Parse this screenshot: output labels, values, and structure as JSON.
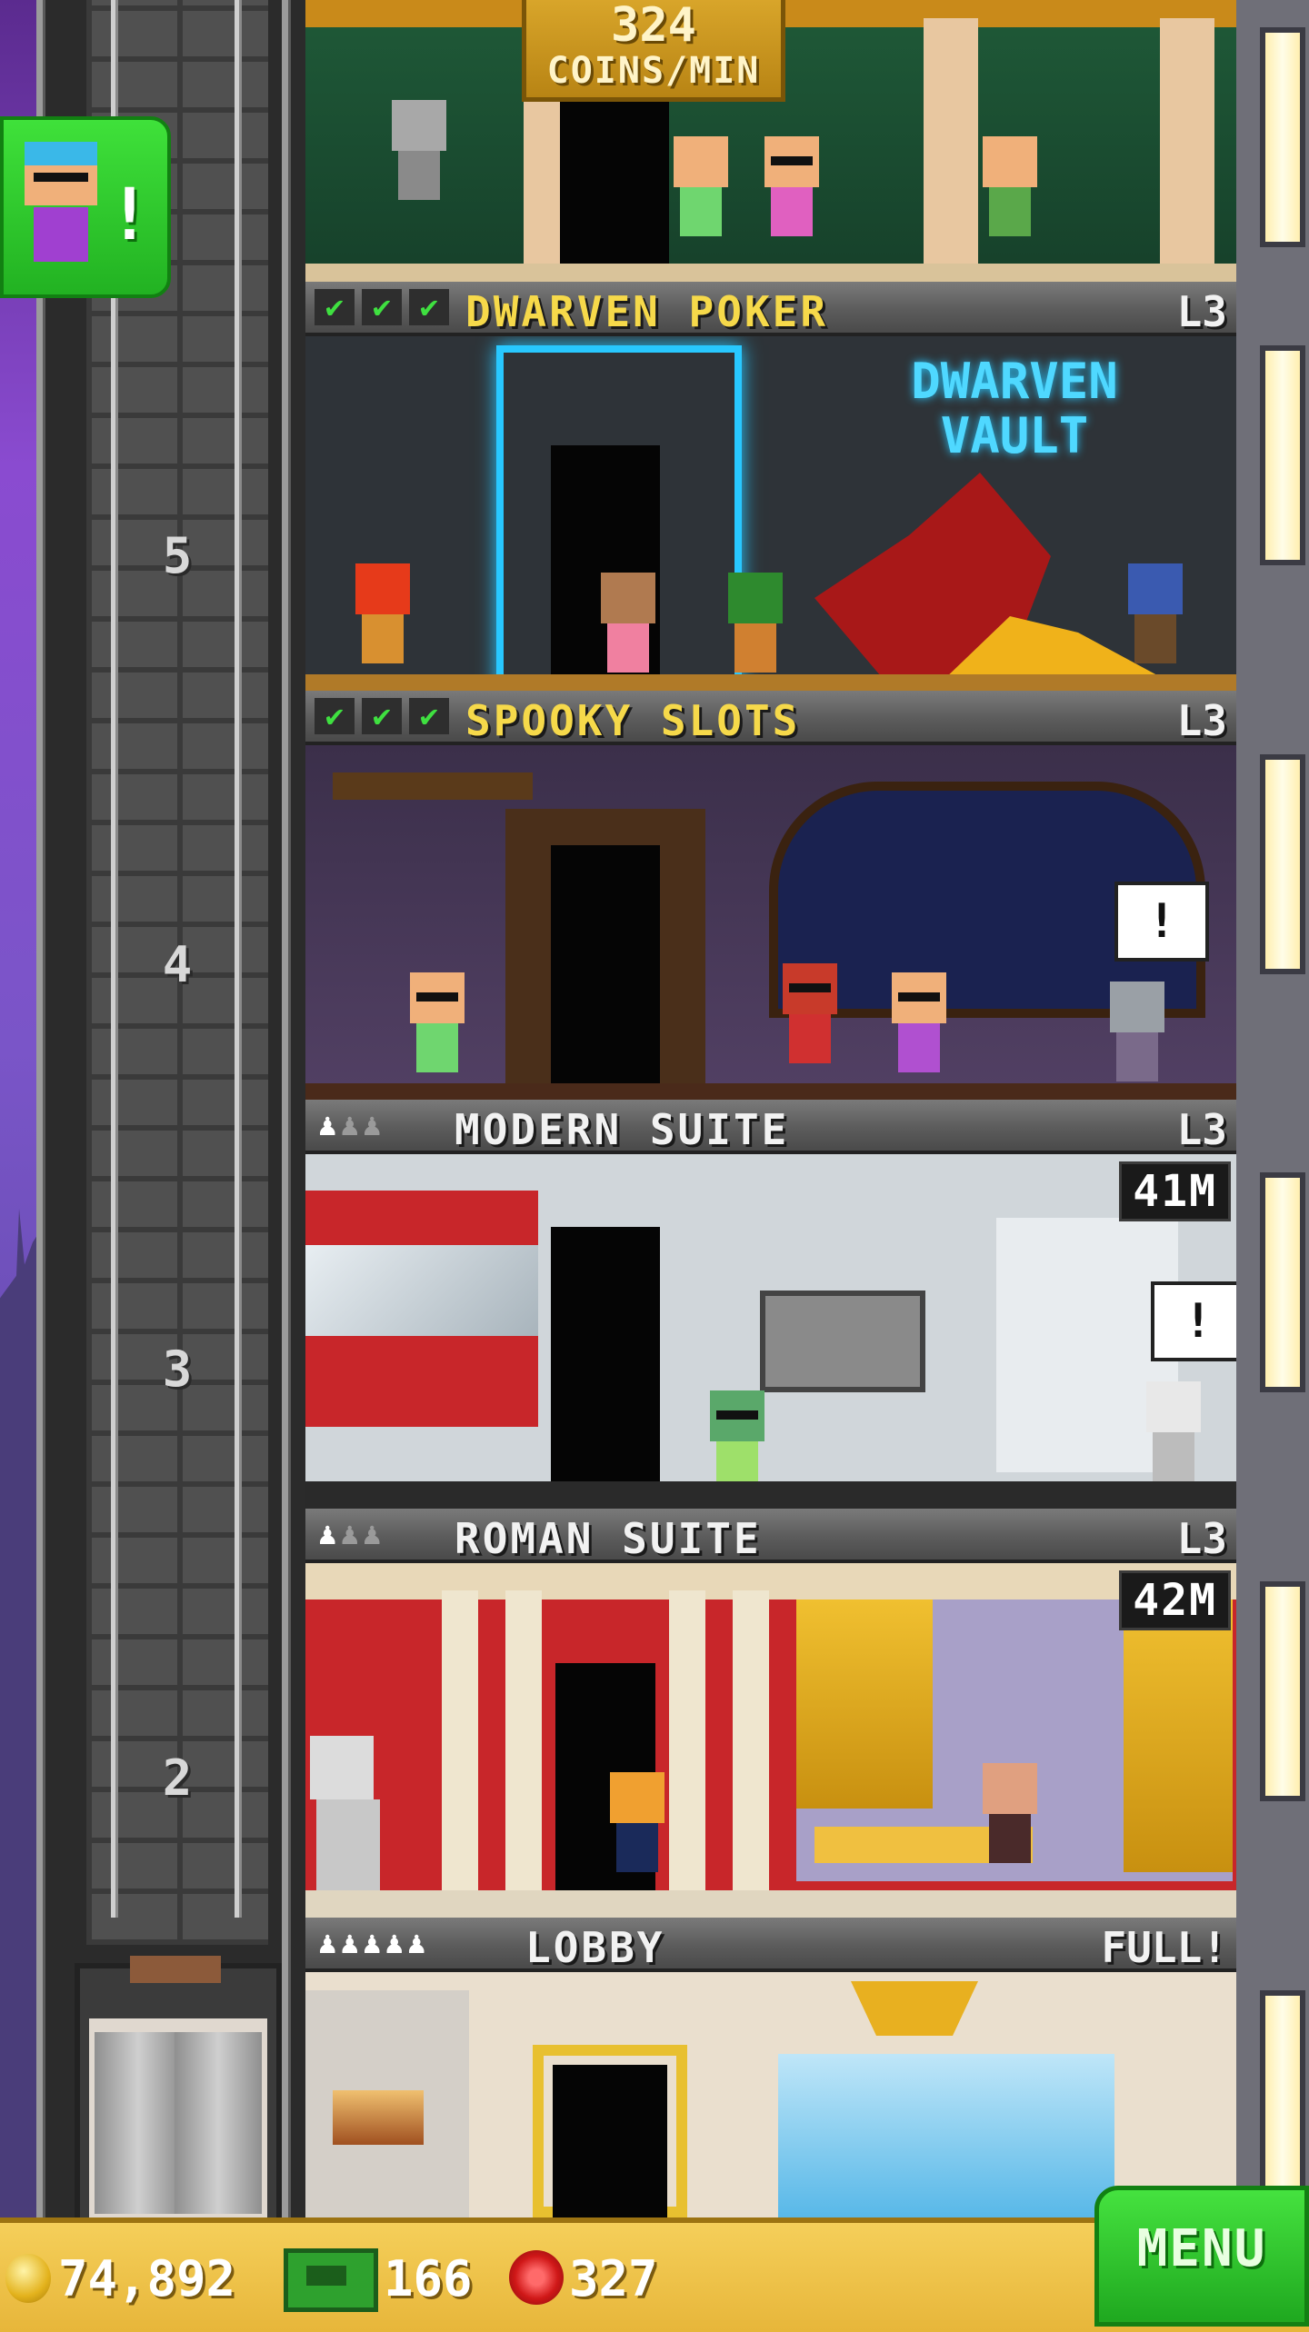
{
  "elevator": {
    "floor_numbers": [
      "5",
      "4",
      "3",
      "2"
    ]
  },
  "coins_per_min": {
    "value": "324",
    "unit": "COINS/MIN"
  },
  "floors": [
    {
      "name": "DWARVEN POKER",
      "level": "L3",
      "type": "business",
      "stars": 3,
      "sign_text_line1": "DWARVEN",
      "sign_text_line2": "VAULT"
    },
    {
      "name": "SPOOKY SLOTS",
      "level": "L3",
      "type": "business",
      "stars": 3,
      "alert": "!"
    },
    {
      "name": "MODERN SUITE",
      "level": "L3",
      "type": "residential",
      "residents": 1,
      "capacity": 3,
      "price": "41M",
      "alert": "!"
    },
    {
      "name": "ROMAN SUITE",
      "level": "L3",
      "type": "residential",
      "residents": 1,
      "capacity": 3,
      "price": "42M"
    },
    {
      "name": "LOBBY",
      "level": "FULL!",
      "type": "lobby",
      "residents": 5,
      "capacity": 5
    }
  ],
  "visitor_alert": "!",
  "resources": {
    "coins": "74,892",
    "bux": "166",
    "gems": "327"
  },
  "menu_label": "MENU",
  "colors": {
    "menu_green": "#22b222",
    "bar_gold": "#e7b63a",
    "business_label": "#f6d94a"
  },
  "icons": {
    "coins": "coin-icon",
    "bux": "bux-icon",
    "gems": "gem-icon",
    "check": "check-icon",
    "person": "person-icon"
  }
}
